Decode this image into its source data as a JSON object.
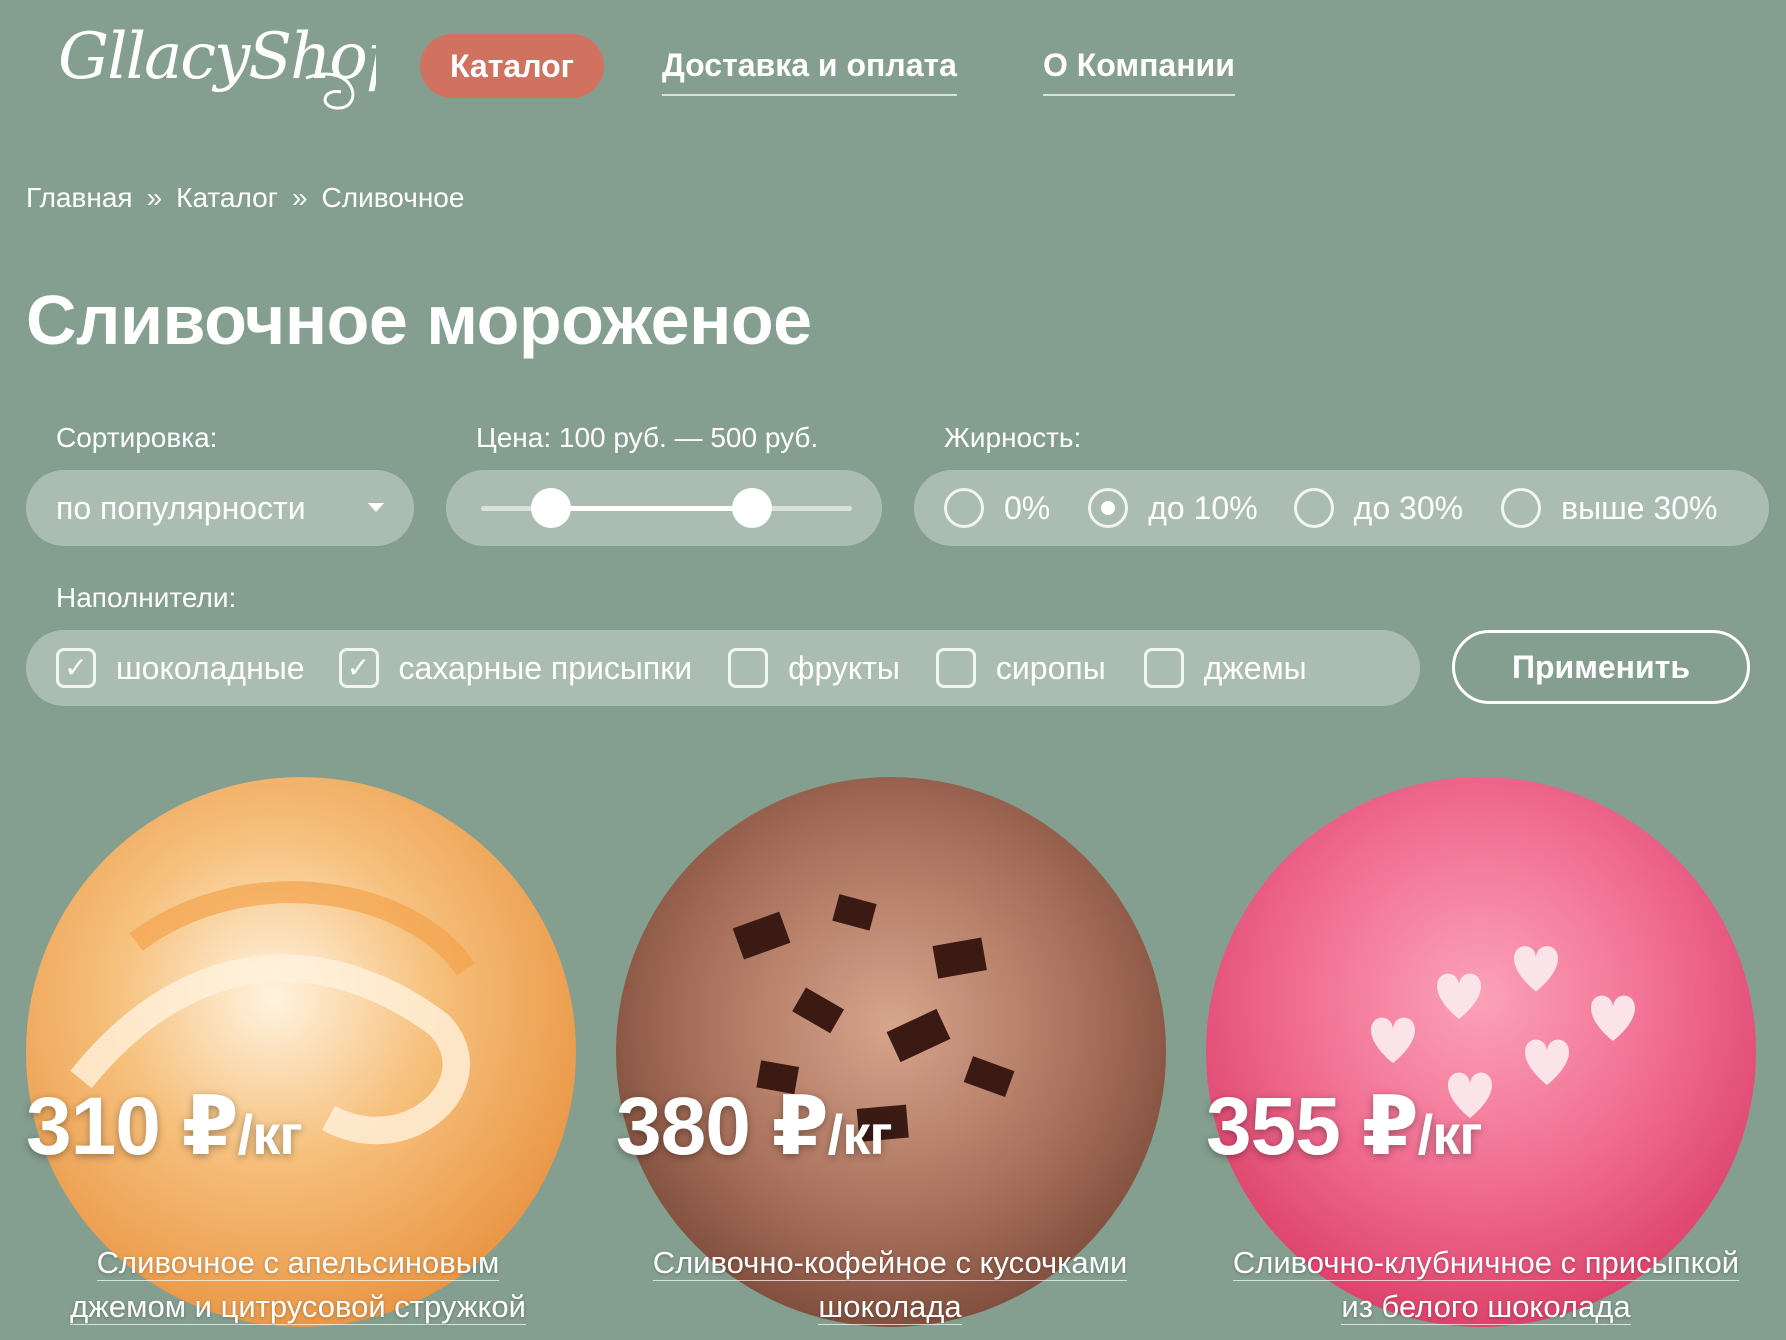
{
  "brand": {
    "logo_text": "GllacyShop"
  },
  "nav": {
    "items": [
      {
        "label": "Каталог",
        "active": true
      },
      {
        "label": "Доставка и оплата",
        "active": false
      },
      {
        "label": "О Компании",
        "active": false
      }
    ]
  },
  "breadcrumb": {
    "items": [
      "Главная",
      "Каталог",
      "Сливочное"
    ],
    "separator": "»"
  },
  "page_title": "Сливочное мороженое",
  "filters": {
    "sort": {
      "label": "Сортировка:",
      "value": "по популярности"
    },
    "price": {
      "label": "Цена: 100 руб. — 500 руб.",
      "min_fraction": 0.19,
      "max_fraction": 0.73
    },
    "fat": {
      "label": "Жирность:",
      "options": [
        {
          "label": "0%",
          "checked": false
        },
        {
          "label": "до 10%",
          "checked": true
        },
        {
          "label": "до 30%",
          "checked": false
        },
        {
          "label": "выше 30%",
          "checked": false
        }
      ]
    },
    "fillers": {
      "label": "Наполнители:",
      "options": [
        {
          "label": "шоколадные",
          "checked": true
        },
        {
          "label": "сахарные присыпки",
          "checked": true
        },
        {
          "label": "фрукты",
          "checked": false
        },
        {
          "label": "сиропы",
          "checked": false
        },
        {
          "label": "джемы",
          "checked": false
        }
      ]
    },
    "apply_label": "Применить"
  },
  "products": [
    {
      "price": "310 ₽",
      "unit": "/кг",
      "name_line1": "Сливочное с апельсиновым",
      "name_line2": "джемом и цитрусовой стружкой",
      "color": "#f2b36a"
    },
    {
      "price": "380 ₽",
      "unit": "/кг",
      "name_line1": "Сливочно-кофейное с кусочками",
      "name_line2": "шоколада",
      "color": "#a36c54"
    },
    {
      "price": "355 ₽",
      "unit": "/кг",
      "name_line1": "Сливочно-клубничное с присыпкой",
      "name_line2": "из белого шоколада",
      "color": "#ef5f86"
    }
  ],
  "colors": {
    "background": "#849e8f",
    "accent": "#d17260"
  }
}
